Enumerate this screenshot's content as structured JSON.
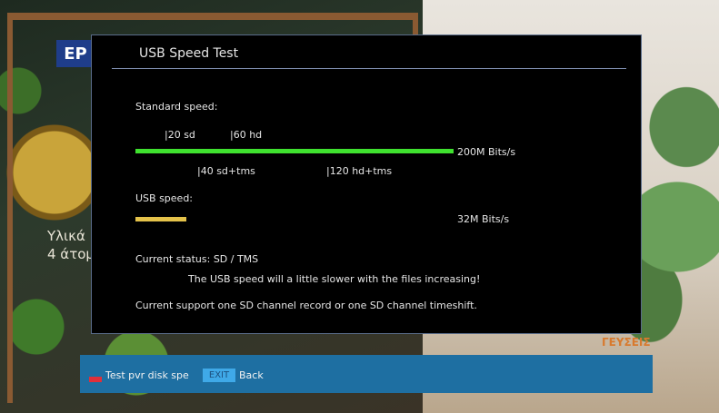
{
  "dialog": {
    "title": "USB Speed Test",
    "standard_label": "Standard speed:",
    "markers_top": [
      "|20 sd",
      "|60 hd"
    ],
    "markers_bottom": [
      "|40 sd+tms",
      "|120 hd+tms"
    ],
    "standard_value": "200M Bits/s",
    "usb_label": "USB speed:",
    "usb_value": "32M Bits/s",
    "usb_fraction_of_standard": 0.16,
    "status": "Current status: SD / TMS",
    "warning": "The USB speed will a little slower with the files increasing!",
    "support": "Current support one SD channel record or one SD channel timeshift."
  },
  "help_bar": {
    "red_key_label": "Test pvr disk spe",
    "exit_key": "EXIT",
    "exit_label": "Back"
  },
  "background": {
    "left_logo": "EP",
    "left_caption_line1": "Υλικά",
    "left_caption_line2": "4 άτομ",
    "right_caption": "ΓΕΥΣΕΙΣ"
  },
  "colors": {
    "standard_bar": "#3fe12f",
    "usb_bar": "#e4c24a",
    "help_bar": "#1e6fa2",
    "red_key": "#e0303a",
    "exit_key": "#3fa9e8"
  }
}
